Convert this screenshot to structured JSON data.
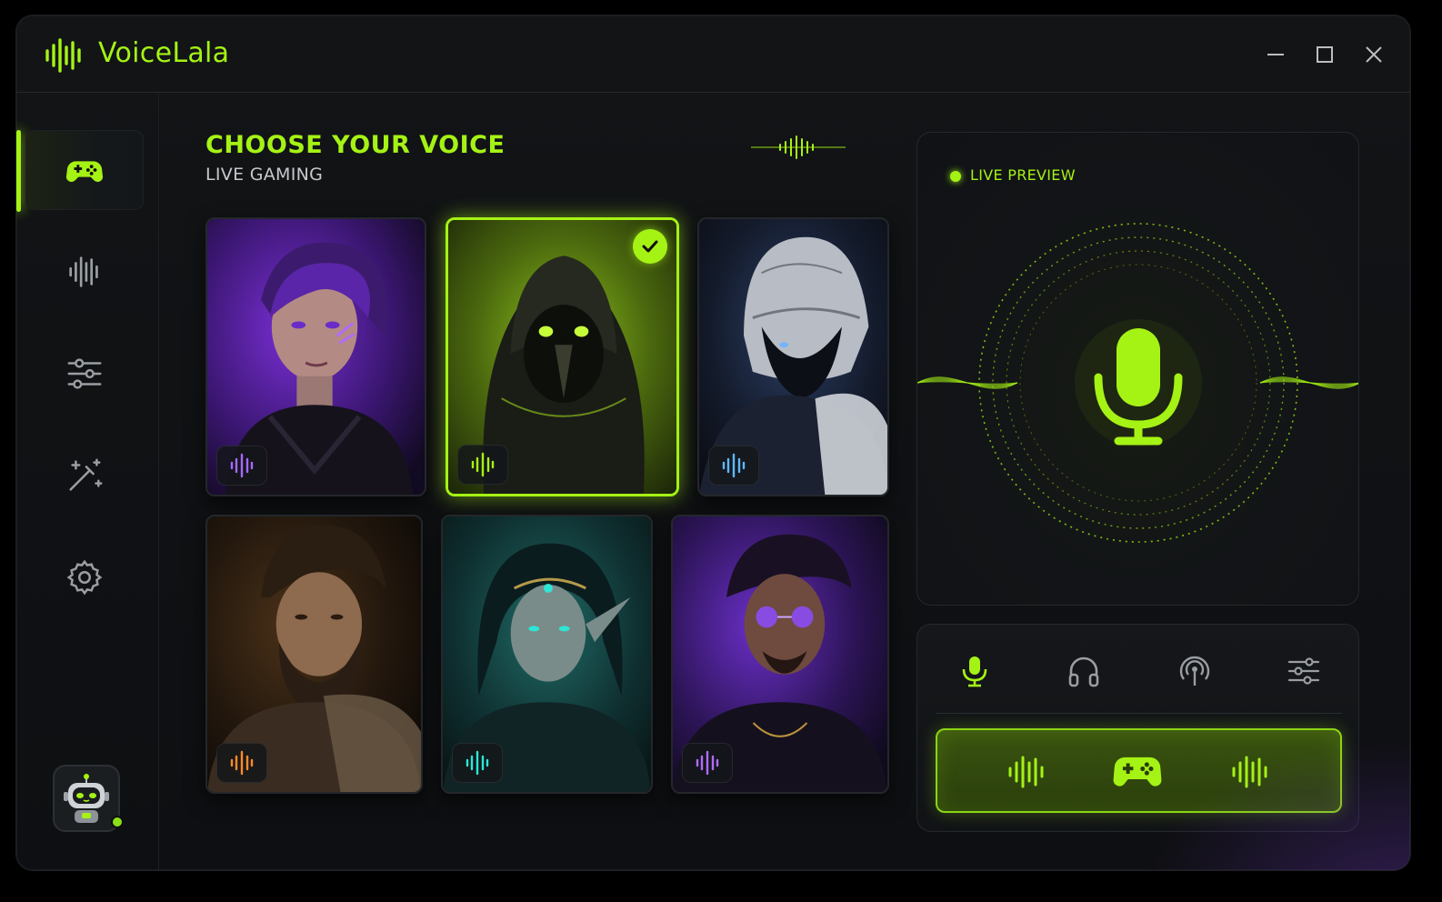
{
  "app": {
    "title": "VoiceLala"
  },
  "window_controls": [
    "minimize-icon",
    "maximize-icon",
    "close-icon"
  ],
  "sidebar": {
    "items": [
      {
        "icon": "gamepad-icon",
        "active": true
      },
      {
        "icon": "waveform-icon",
        "active": false
      },
      {
        "icon": "sliders-icon",
        "active": false
      },
      {
        "icon": "magic-wand-icon",
        "active": false
      },
      {
        "icon": "gear-icon",
        "active": false
      }
    ],
    "assistant": {
      "icon": "robot-icon",
      "status": "online"
    }
  },
  "header": {
    "title": "CHOOSE YOUR VOICE",
    "subtitle": "LIVE GAMING"
  },
  "voices": [
    {
      "theme": "purple-punk-woman",
      "badge_color": "#a768ff",
      "selected": false
    },
    {
      "theme": "green-hooded-plague",
      "badge_color": "#a5f215",
      "selected": true
    },
    {
      "theme": "silver-armored-knight",
      "badge_color": "#5fb8ff",
      "selected": false
    },
    {
      "theme": "bearded-warrior",
      "badge_color": "#ff8a2a",
      "selected": false
    },
    {
      "theme": "teal-elf",
      "badge_color": "#2ee6d6",
      "selected": false
    },
    {
      "theme": "purple-shades-man",
      "badge_color": "#b06cff",
      "selected": false
    }
  ],
  "preview": {
    "label": "LIVE PREVIEW",
    "icon": "microphone-icon"
  },
  "controls": {
    "icons": [
      "microphone-icon",
      "headphones-icon",
      "broadcast-icon",
      "sliders-icon"
    ],
    "mode_bar": [
      "waveform-icon",
      "gamepad-icon",
      "waveform-icon"
    ]
  },
  "colors": {
    "accent": "#a5f215",
    "background": "#0e0f12",
    "panel": "#121417"
  }
}
